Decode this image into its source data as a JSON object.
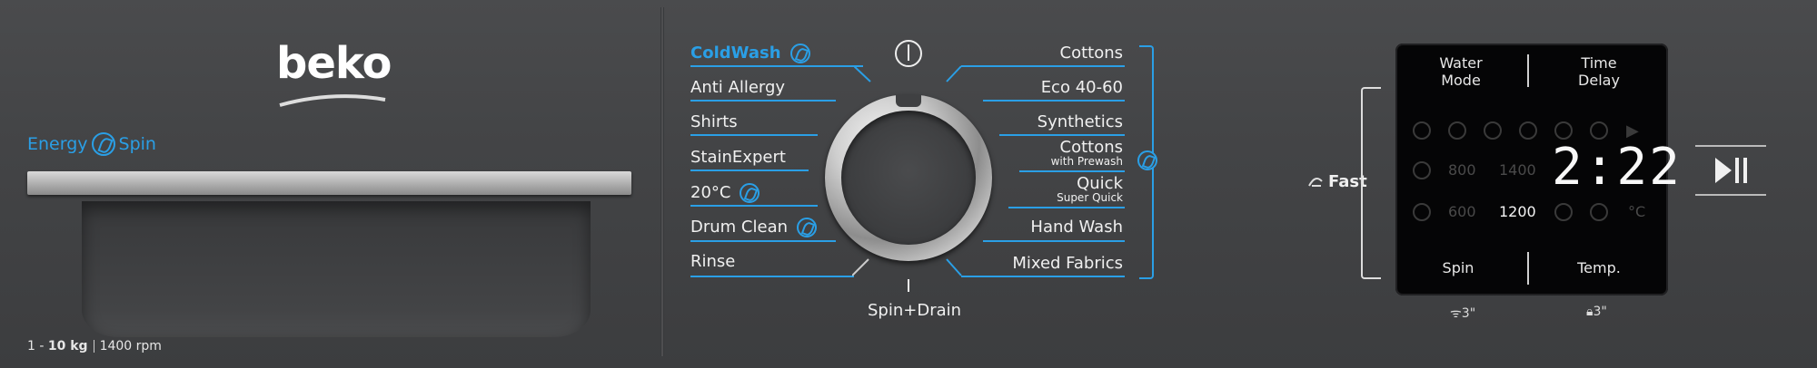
{
  "brand": {
    "logo": "beko"
  },
  "drawer": {
    "energy_label_left": "Energy",
    "energy_label_right": "Spin",
    "capacity_prefix": "1 - ",
    "capacity_value": "10 kg",
    "speed": "1400 rpm"
  },
  "programs_left": [
    {
      "label": "ColdWash",
      "eco": true,
      "highlight": true
    },
    {
      "label": "Anti Allergy",
      "eco": false
    },
    {
      "label": "Shirts",
      "eco": false
    },
    {
      "label": "StainExpert",
      "eco": false
    },
    {
      "label": "20°C",
      "eco": true
    },
    {
      "label": "Drum Clean",
      "eco": true
    },
    {
      "label": "Rinse",
      "eco": false
    }
  ],
  "programs_right": [
    {
      "label": "Cottons",
      "sub": ""
    },
    {
      "label": "Eco 40-60",
      "sub": ""
    },
    {
      "label": "Synthetics",
      "sub": ""
    },
    {
      "label": "Cottons",
      "sub": "with Prewash"
    },
    {
      "label": "Quick",
      "sub": "Super Quick"
    },
    {
      "label": "Hand Wash",
      "sub": ""
    },
    {
      "label": "Mixed Fabrics",
      "sub": ""
    }
  ],
  "dial_bottom": "Spin+Drain",
  "fast_label": "Fast",
  "display": {
    "top_left": "Water\nMode",
    "top_left_l1": "Water",
    "top_left_l2": "Mode",
    "top_right_l1": "Time",
    "top_right_l2": "Delay",
    "time": "2:22",
    "spin_values": [
      "800",
      "1400",
      "600",
      "1200"
    ],
    "active_spin": "1200",
    "bottom_left": "Spin",
    "bottom_right": "Temp."
  },
  "under_display": {
    "left_hint": "3\"",
    "right_hint": "3\""
  },
  "colors": {
    "accent": "#2a9fe6",
    "panel": "#434446",
    "display_bg": "#050506"
  }
}
